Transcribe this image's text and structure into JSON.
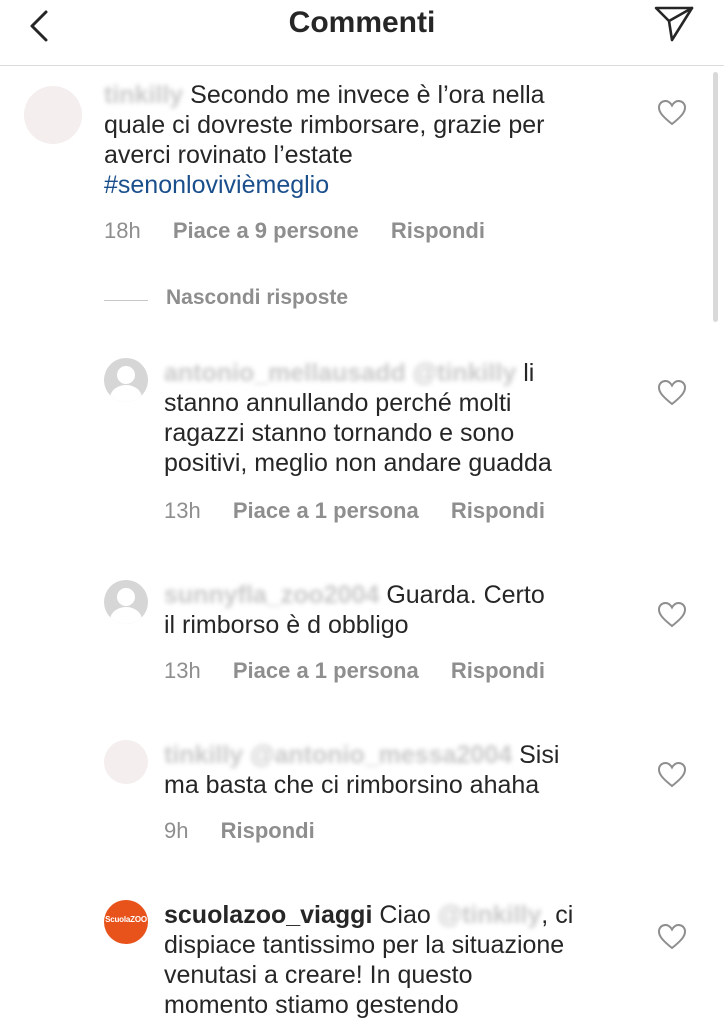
{
  "header": {
    "title": "Commenti"
  },
  "comments": [
    {
      "username_blurred": "tinkilly",
      "text_lines": [
        "Secondo me invece è l’ora nella",
        "quale ci dovreste rimborsare, grazie per",
        "averci rovinato l’estate"
      ],
      "hashtag": "#senonlovivièmeglio",
      "time": "18h",
      "likes": "Piace a 9 persone",
      "reply": "Rispondi"
    }
  ],
  "hide_replies": "Nascondi risposte",
  "replies": [
    {
      "username_blurred": "antonio_mellausadd @tinkilly",
      "first_tail": "li",
      "text_lines": [
        "stanno annullando perché molti",
        "ragazzi stanno tornando e sono",
        "positivi, meglio non andare guadda"
      ],
      "time": "13h",
      "likes": "Piace a 1 persona",
      "reply": "Rispondi"
    },
    {
      "username_blurred": "sunnyfla_zoo2004",
      "first_tail": "Guarda. Certo",
      "text_lines": [
        "il rimborso è d obbligo"
      ],
      "time": "13h",
      "likes": "Piace a 1 persona",
      "reply": "Rispondi"
    },
    {
      "username_blurred": "tinkilly @antonio_messa2004",
      "first_tail": "Sisi",
      "text_lines": [
        "ma basta che ci rimborsino ahaha"
      ],
      "time": "9h",
      "reply": "Rispondi"
    },
    {
      "username": "scuolazoo_viaggi",
      "avatar_text": "ScuolaZOO",
      "first_text": "Ciao",
      "mention_blurred": "@tinkilly",
      "first_tail": ", ci",
      "text_lines": [
        "dispiace tantissimo per la situazione",
        "venutasi a creare! In questo",
        "momento stiamo gestendo"
      ]
    }
  ],
  "colors": {
    "text": "#262626",
    "meta": "#8e8e8e",
    "hashtag": "#1b4f8c",
    "brand": "#e8531c"
  }
}
